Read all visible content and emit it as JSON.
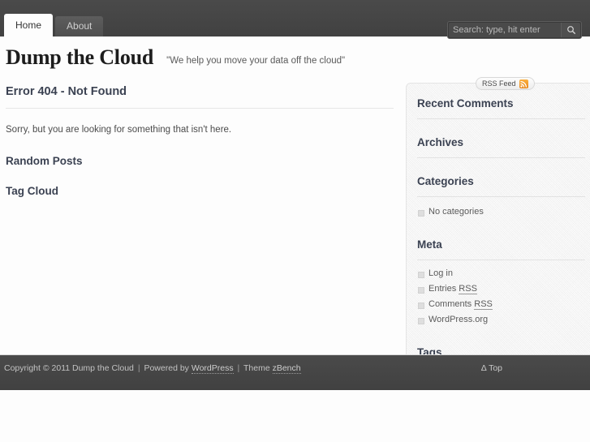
{
  "nav": {
    "items": [
      {
        "label": "Home",
        "active": true
      },
      {
        "label": "About",
        "active": false
      }
    ]
  },
  "search": {
    "placeholder": "Search: type, hit enter",
    "value": "",
    "icon": "search-icon"
  },
  "branding": {
    "title": "Dump the Cloud",
    "description": "\"We help you move your data off the cloud\""
  },
  "main": {
    "heading": "Error 404 - Not Found",
    "body": "Sorry, but you are looking for something that isn't here.",
    "sections": [
      {
        "heading": "Random Posts"
      },
      {
        "heading": "Tag Cloud"
      }
    ]
  },
  "sidebar": {
    "rss": {
      "label": "RSS Feed",
      "icon": "rss-icon"
    },
    "widgets": [
      {
        "title": "Recent Comments",
        "items": []
      },
      {
        "title": "Archives",
        "items": []
      },
      {
        "title": "Categories",
        "items": [
          {
            "label": "No categories",
            "link": false
          }
        ]
      },
      {
        "title": "Meta",
        "items": [
          {
            "label": "Log in",
            "link": true
          },
          {
            "label": "Entries ",
            "abbr": "RSS",
            "link": true
          },
          {
            "label": "Comments ",
            "abbr": "RSS",
            "link": true
          },
          {
            "label": "WordPress.org",
            "link": true
          }
        ]
      },
      {
        "title": "Tags",
        "items": []
      }
    ]
  },
  "footer": {
    "copyright_prefix": "Copyright © 2011 Dump the Cloud",
    "powered_by_prefix": "Powered by ",
    "powered_by_link": "WordPress",
    "theme_prefix": "Theme ",
    "theme_link": "zBench",
    "separator": "|",
    "to_top": "Δ Top"
  },
  "colors": {
    "chrome": "#454545",
    "accent_rss": "#f19a1a",
    "heading": "#3b4252",
    "page_bg": "#fdfdfd"
  }
}
